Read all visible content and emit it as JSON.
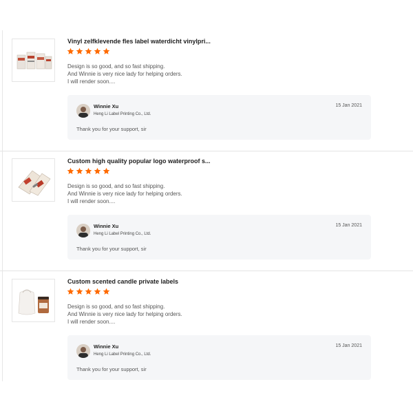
{
  "colors": {
    "star": "#ff6a00",
    "reply_bg": "#f5f6f8",
    "divider": "#e4e4e4"
  },
  "reviews": [
    {
      "title": "Vinyl zelfklevende fles label waterdicht vinylpri...",
      "rating": 5,
      "comment_lines": [
        "Design is so good, and so fast shipping.",
        "And Winnie is very nice lady for helping orders.",
        "I will render soon...."
      ],
      "reply": {
        "name": "Winnie Xu",
        "company": "Heng Li Label Printing Co., Ltd.",
        "date": "15 Jan 2021",
        "text": "Thank you for your support, sir"
      }
    },
    {
      "title": "Custom high quality popular logo waterproof s...",
      "rating": 5,
      "comment_lines": [
        "Design is so good, and so fast shipping.",
        "And Winnie is very nice lady for helping orders.",
        "I will render soon...."
      ],
      "reply": {
        "name": "Winnie Xu",
        "company": "Heng Li Label Printing Co., Ltd.",
        "date": "15 Jan 2021",
        "text": "Thank you for your support, sir"
      }
    },
    {
      "title": "Custom scented candle private labels",
      "rating": 5,
      "comment_lines": [
        "Design is so good, and so fast shipping.",
        "And Winnie is very nice lady for helping orders.",
        "I will render soon...."
      ],
      "reply": {
        "name": "Winnie Xu",
        "company": "Heng Li Label Printing Co., Ltd.",
        "date": "15 Jan 2021",
        "text": "Thank you for your support, sir"
      }
    }
  ]
}
